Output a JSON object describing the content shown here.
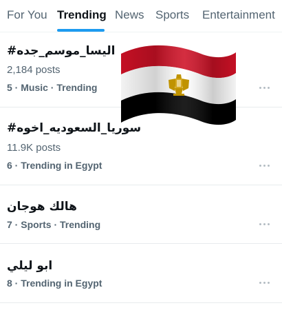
{
  "tabs": [
    {
      "label": "For You",
      "active": false
    },
    {
      "label": "Trending",
      "active": true
    },
    {
      "label": "News",
      "active": false
    },
    {
      "label": "Sports",
      "active": false
    },
    {
      "label": "Entertainment",
      "active": false
    }
  ],
  "accent_color": "#1d9bf0",
  "trends": [
    {
      "name": "#اليسا_موسم_جده",
      "count": "2,184 posts",
      "meta": "5 · Music · Trending"
    },
    {
      "name": "#سوريا_السعوديه_اخوه",
      "count": "11.9K posts",
      "meta": "6 · Trending in Egypt"
    },
    {
      "name": "هالك هوجان",
      "count": "",
      "meta": "7 · Sports · Trending"
    },
    {
      "name": "ابو ليلي",
      "count": "",
      "meta": "8 · Trending in Egypt"
    }
  ],
  "more_icon": "more-horizontal-icon",
  "overlay_image": {
    "name": "egypt-flag",
    "colors": [
      "#ce1126",
      "#ffffff",
      "#000000",
      "#c09300"
    ]
  }
}
